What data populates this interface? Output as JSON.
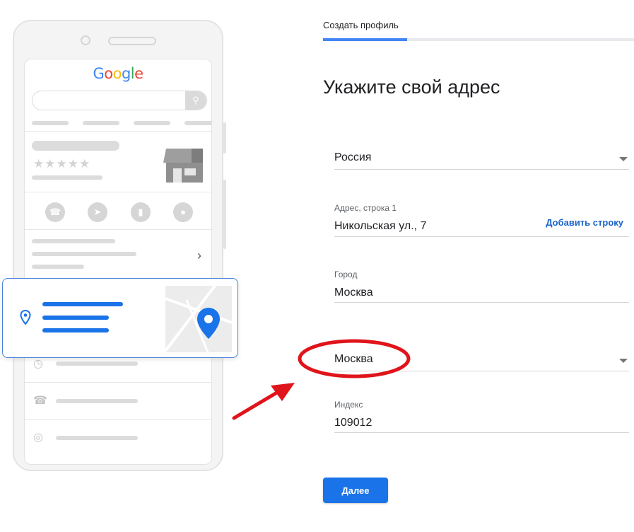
{
  "illustration": {
    "logo_text": "Google",
    "accent_color": "#1a73e8",
    "icons": [
      "search-icon",
      "phone-icon",
      "directions-icon",
      "bookmark-icon",
      "globe-icon",
      "chevron-right-icon",
      "clock-icon",
      "location-pin-icon",
      "map-pin-icon",
      "storefront-icon"
    ]
  },
  "header": {
    "tab_label": "Создать профиль",
    "progress_fraction": 0.27
  },
  "form": {
    "title": "Укажите свой адрес",
    "country": {
      "value": "Россия"
    },
    "address_line1": {
      "label": "Адрес, строка 1",
      "value": "Никольская ул., 7",
      "add_line_label": "Добавить строку"
    },
    "city": {
      "label": "Город",
      "value": "Москва"
    },
    "region": {
      "value": "Москва"
    },
    "postal_code": {
      "label": "Индекс",
      "value": "109012"
    },
    "next_button_label": "Далее"
  },
  "colors": {
    "primary_button": "#1a73e8",
    "annotation_red": "#e0141b",
    "progress": "#4285f4"
  }
}
